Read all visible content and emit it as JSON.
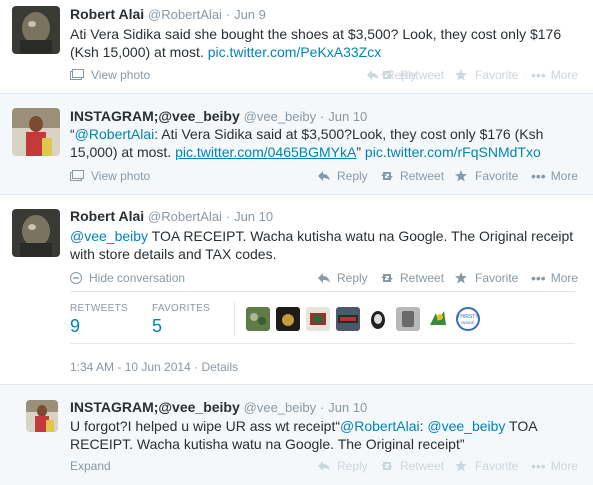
{
  "tweets": [
    {
      "name": "Robert Alai",
      "handle": "@RobertAlai",
      "time": "Jun 9",
      "text": "Ati Vera Sidika said she bought the shoes at $3,500? Look, they cost only $176 (Ksh 15,000) at most.",
      "link": "pic.twitter.com/PeKxA33Zcx",
      "media_label": "View photo"
    },
    {
      "name": "INSTAGRAM;@vee_beiby",
      "handle": "@vee_beiby",
      "time": "Jun 10",
      "text_open": "“",
      "mention": "@RobertAlai",
      "text_mid": ": Ati Vera Sidika said at $3,500?Look, they cost only $176 (Ksh 15,000) at most.",
      "link1": "pic.twitter.com/0465BGMYkA",
      "text_close": "” ",
      "link2": "pic.twitter.com/rFqSNMdTxo",
      "media_label": "View photo"
    },
    {
      "name": "Robert Alai",
      "handle": "@RobertAlai",
      "time": "Jun 10",
      "mention": "@vee_beiby",
      "text": " TOA RECEIPT. Wacha kutisha watu na Google. The Original receipt with store details and TAX codes.",
      "hide_label": "Hide conversation",
      "retweets_label": "RETWEETS",
      "retweets_count": "9",
      "favorites_label": "FAVORITES",
      "favorites_count": "5",
      "datetime": "1:34 AM - 10 Jun 2014",
      "details_label": "Details"
    },
    {
      "name": "INSTAGRAM;@vee_beiby",
      "handle": "@vee_beiby",
      "time": "Jun 10",
      "text_a": "U forgot?I helped u wipe UR ass wt receipt“",
      "mention1": "@RobertAlai",
      "text_b": ": ",
      "mention2": "@vee_beiby",
      "text_c": " TOA RECEIPT. Wacha kutisha watu na Google. The Original receipt”",
      "expand_label": "Expand"
    }
  ],
  "actions": {
    "reply": "Reply",
    "retweet": "Retweet",
    "favorite": "Favorite",
    "more": "More"
  },
  "dot": "·",
  "colors": {
    "link": "#0084b4",
    "muted": "#8899a6",
    "text": "#292f33"
  }
}
